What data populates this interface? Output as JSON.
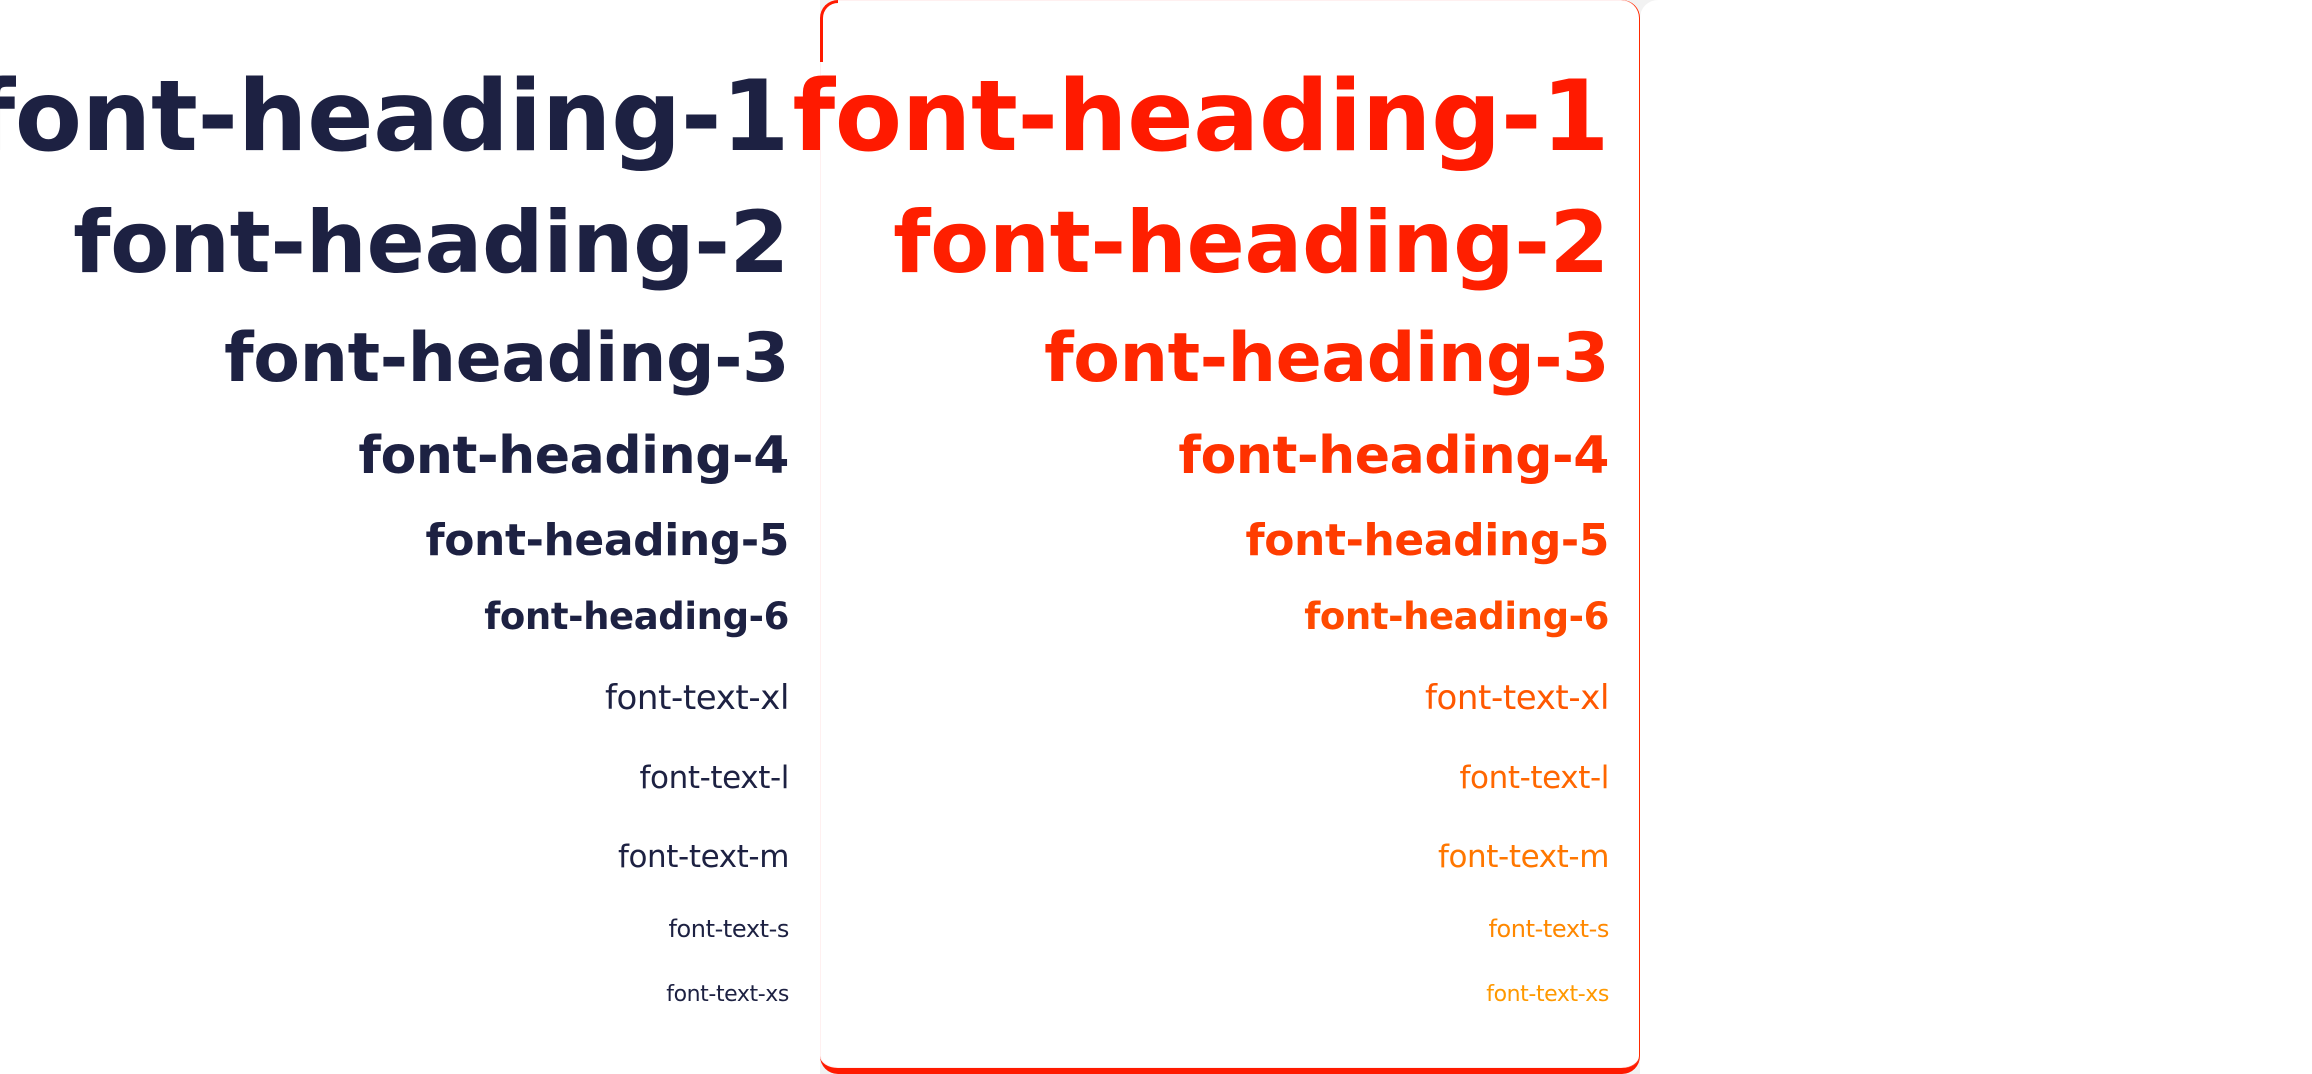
{
  "colors": {
    "default_text": "#1d2142",
    "gradient_top": "#ff1a00",
    "gradient_bottom": "#ff9900"
  },
  "samples": [
    "font-heading-1",
    "font-heading-2",
    "font-heading-3",
    "font-heading-4",
    "font-heading-5",
    "font-heading-6",
    "font-text-xl",
    "font-text-l",
    "font-text-m",
    "font-text-s",
    "font-text-xs"
  ]
}
